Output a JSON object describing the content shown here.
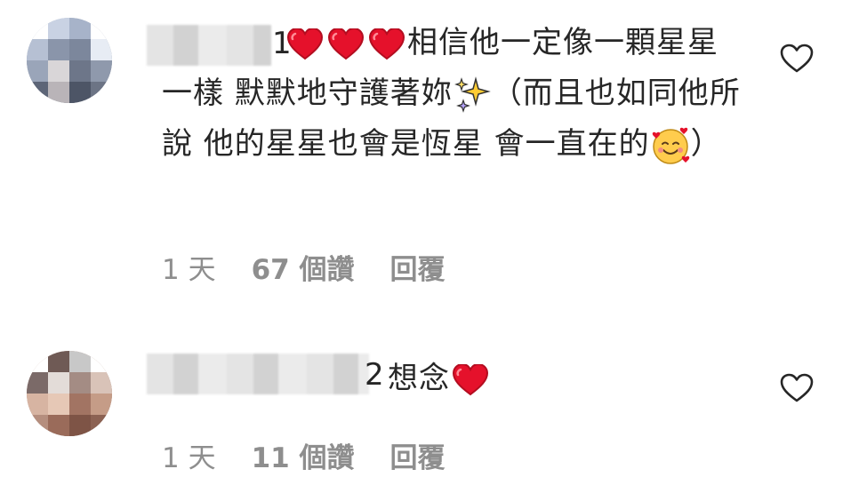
{
  "comments": [
    {
      "username_tail": "1",
      "text_part1": "相信他一定像一顆星星一樣 默默地守護著妳",
      "text_part2": "（而且也如同他所說 他的星星也會是恆星 會一直在的",
      "text_part3": "）",
      "time": "1 天",
      "likes": "67 個讚",
      "reply_label": "回覆",
      "icons": [
        "red-heart-emoji",
        "red-heart-emoji",
        "red-heart-emoji",
        "sparkles-emoji",
        "smiling-face-with-hearts-emoji",
        "heart-outline-icon"
      ]
    },
    {
      "username_tail": "2",
      "text_part1": "想念",
      "time": "1 天",
      "likes": "11 個讚",
      "reply_label": "回覆",
      "icons": [
        "red-heart-emoji",
        "heart-outline-icon"
      ]
    }
  ],
  "colors": {
    "text": "#262626",
    "meta": "#8e8e8e",
    "heart_red": "#e5112b",
    "background": "#ffffff"
  }
}
